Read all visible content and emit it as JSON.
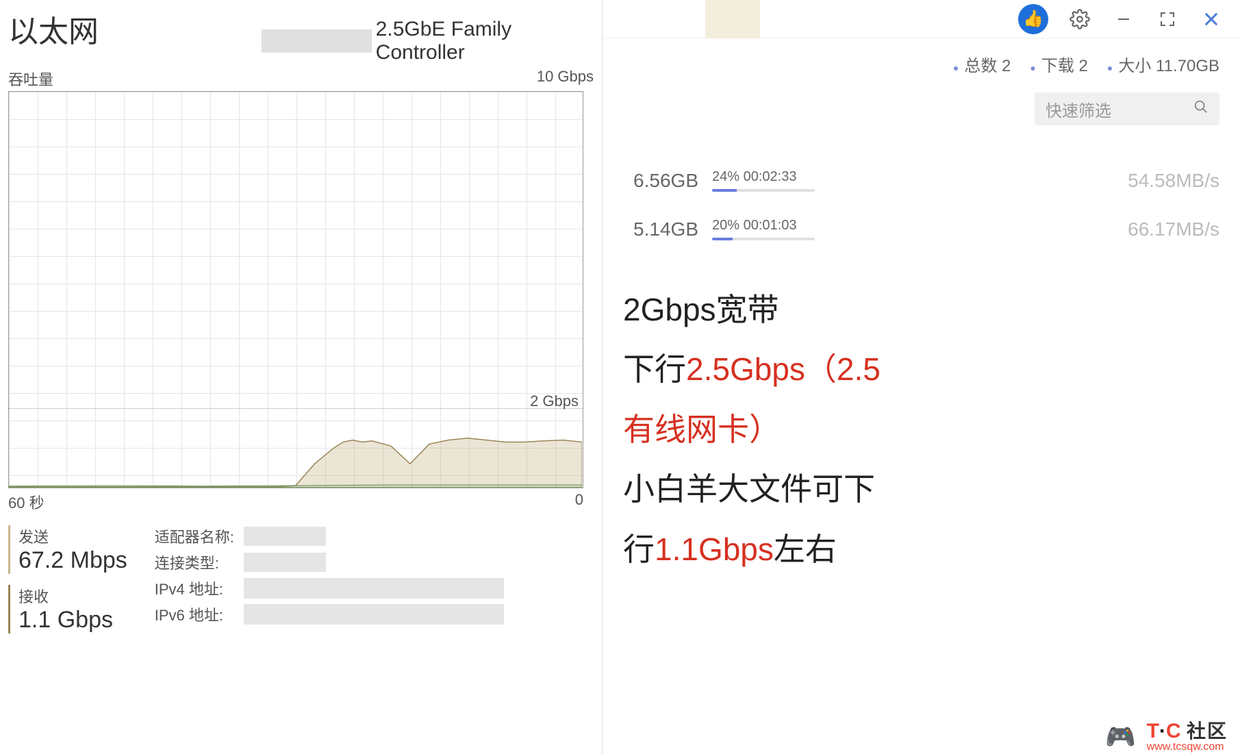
{
  "left": {
    "title": "以太网",
    "controller": "2.5GbE Family Controller",
    "throughput_label": "吞吐量",
    "throughput_max": "10 Gbps",
    "time_start": "60 秒",
    "time_end": "0",
    "send_label": "发送",
    "send_value": "67.2 Mbps",
    "recv_label": "接收",
    "recv_value": "1.1 Gbps",
    "adapter_name_label": "适配器名称:",
    "conn_type_label": "连接类型:",
    "ipv4_label": "IPv4 地址:",
    "ipv6_label": "IPv6 地址:"
  },
  "chart_data": {
    "type": "area",
    "title": "吞吐量",
    "xlabel": "秒",
    "ylabel": "Gbps",
    "ylim": [
      0,
      10
    ],
    "xlim": [
      60,
      0
    ],
    "marker_line": {
      "label": "2 Gbps",
      "value": 2
    },
    "series": [
      {
        "name": "接收",
        "color": "#b8a06a",
        "x": [
          60,
          56,
          52,
          48,
          44,
          40,
          36,
          32,
          30,
          28,
          26,
          25,
          24,
          23,
          22,
          20,
          18,
          16,
          14,
          12,
          10,
          8,
          6,
          4,
          2,
          0
        ],
        "y": [
          0.02,
          0.02,
          0.02,
          0.02,
          0.02,
          0.02,
          0.02,
          0.02,
          0.05,
          0.6,
          1.0,
          1.15,
          1.2,
          1.15,
          1.18,
          1.05,
          0.6,
          1.1,
          1.2,
          1.25,
          1.2,
          1.15,
          1.15,
          1.18,
          1.2,
          1.15
        ]
      },
      {
        "name": "发送",
        "color": "#8cb97a",
        "x": [
          60,
          50,
          40,
          30,
          20,
          10,
          0
        ],
        "y": [
          0.04,
          0.05,
          0.04,
          0.05,
          0.07,
          0.07,
          0.07
        ]
      }
    ]
  },
  "right": {
    "summary": {
      "total_label": "总数",
      "total_val": "2",
      "dl_label": "下载",
      "dl_val": "2",
      "size_label": "大小",
      "size_val": "11.70GB"
    },
    "filter_placeholder": "快速筛选",
    "downloads": [
      {
        "size": "6.56GB",
        "percent": 24,
        "percent_text": "24%",
        "eta": "00:02:33",
        "speed": "54.58MB/s"
      },
      {
        "size": "5.14GB",
        "percent": 20,
        "percent_text": "20%",
        "eta": "00:01:03",
        "speed": "66.17MB/s"
      }
    ],
    "ann_line1": "2Gbps宽带",
    "ann_line2_a": "下行",
    "ann_line2_b": "2.5Gbps（2.5",
    "ann_line3": "有线网卡）",
    "ann_line4": "小白羊大文件可下",
    "ann_line5_a": "行",
    "ann_line5_b": "1.1Gbps",
    "ann_line5_c": "左右"
  },
  "watermark": {
    "brand": "T·C",
    "sub": "社区",
    "url": "www.tcsqw.com"
  }
}
